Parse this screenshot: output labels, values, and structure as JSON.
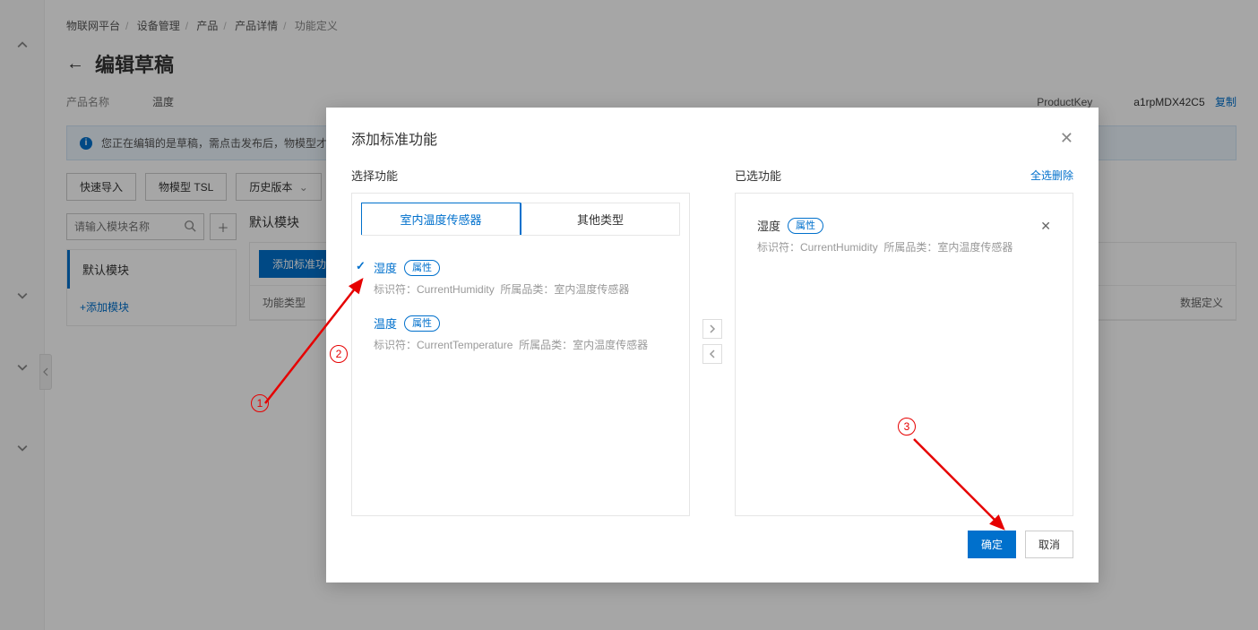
{
  "breadcrumb": {
    "p1": "物联网平台",
    "p2": "设备管理",
    "p3": "产品",
    "p4": "产品详情",
    "p5": "功能定义"
  },
  "page_title": "编辑草稿",
  "meta": {
    "name_label": "产品名称",
    "name_value": "温度",
    "pk_label": "ProductKey",
    "pk_value": "a1rpMDX42C5",
    "copy": "复制"
  },
  "info_bar": {
    "text": "您正在编辑的是草稿，需点击发布后，物模型才"
  },
  "toolbar": {
    "quick_import": "快速导入",
    "tsl": "物模型 TSL",
    "history": "历史版本"
  },
  "search": {
    "placeholder": "请输入模块名称"
  },
  "module": {
    "default": "默认模块",
    "add": "+添加模块"
  },
  "main": {
    "heading": "默认模块",
    "add_std": "添加标准功能",
    "th_type": "功能类型",
    "th_data": "数据定义"
  },
  "dialog": {
    "title": "添加标准功能",
    "left_label": "选择功能",
    "right_label": "已选功能",
    "clear_all": "全选删除",
    "tab1": "室内温度传感器",
    "tab2": "其他类型",
    "items": [
      {
        "name": "湿度",
        "badge": "属性",
        "id_label": "标识符：",
        "id": "CurrentHumidity",
        "cat_label": "所属品类：",
        "cat": "室内温度传感器",
        "selected": true
      },
      {
        "name": "温度",
        "badge": "属性",
        "id_label": "标识符：",
        "id": "CurrentTemperature",
        "cat_label": "所属品类：",
        "cat": "室内温度传感器",
        "selected": false
      }
    ],
    "chosen": [
      {
        "name": "湿度",
        "badge": "属性",
        "id_label": "标识符：",
        "id": "CurrentHumidity",
        "cat_label": "所属品类：",
        "cat": "室内温度传感器"
      }
    ],
    "ok": "确定",
    "cancel": "取消"
  }
}
